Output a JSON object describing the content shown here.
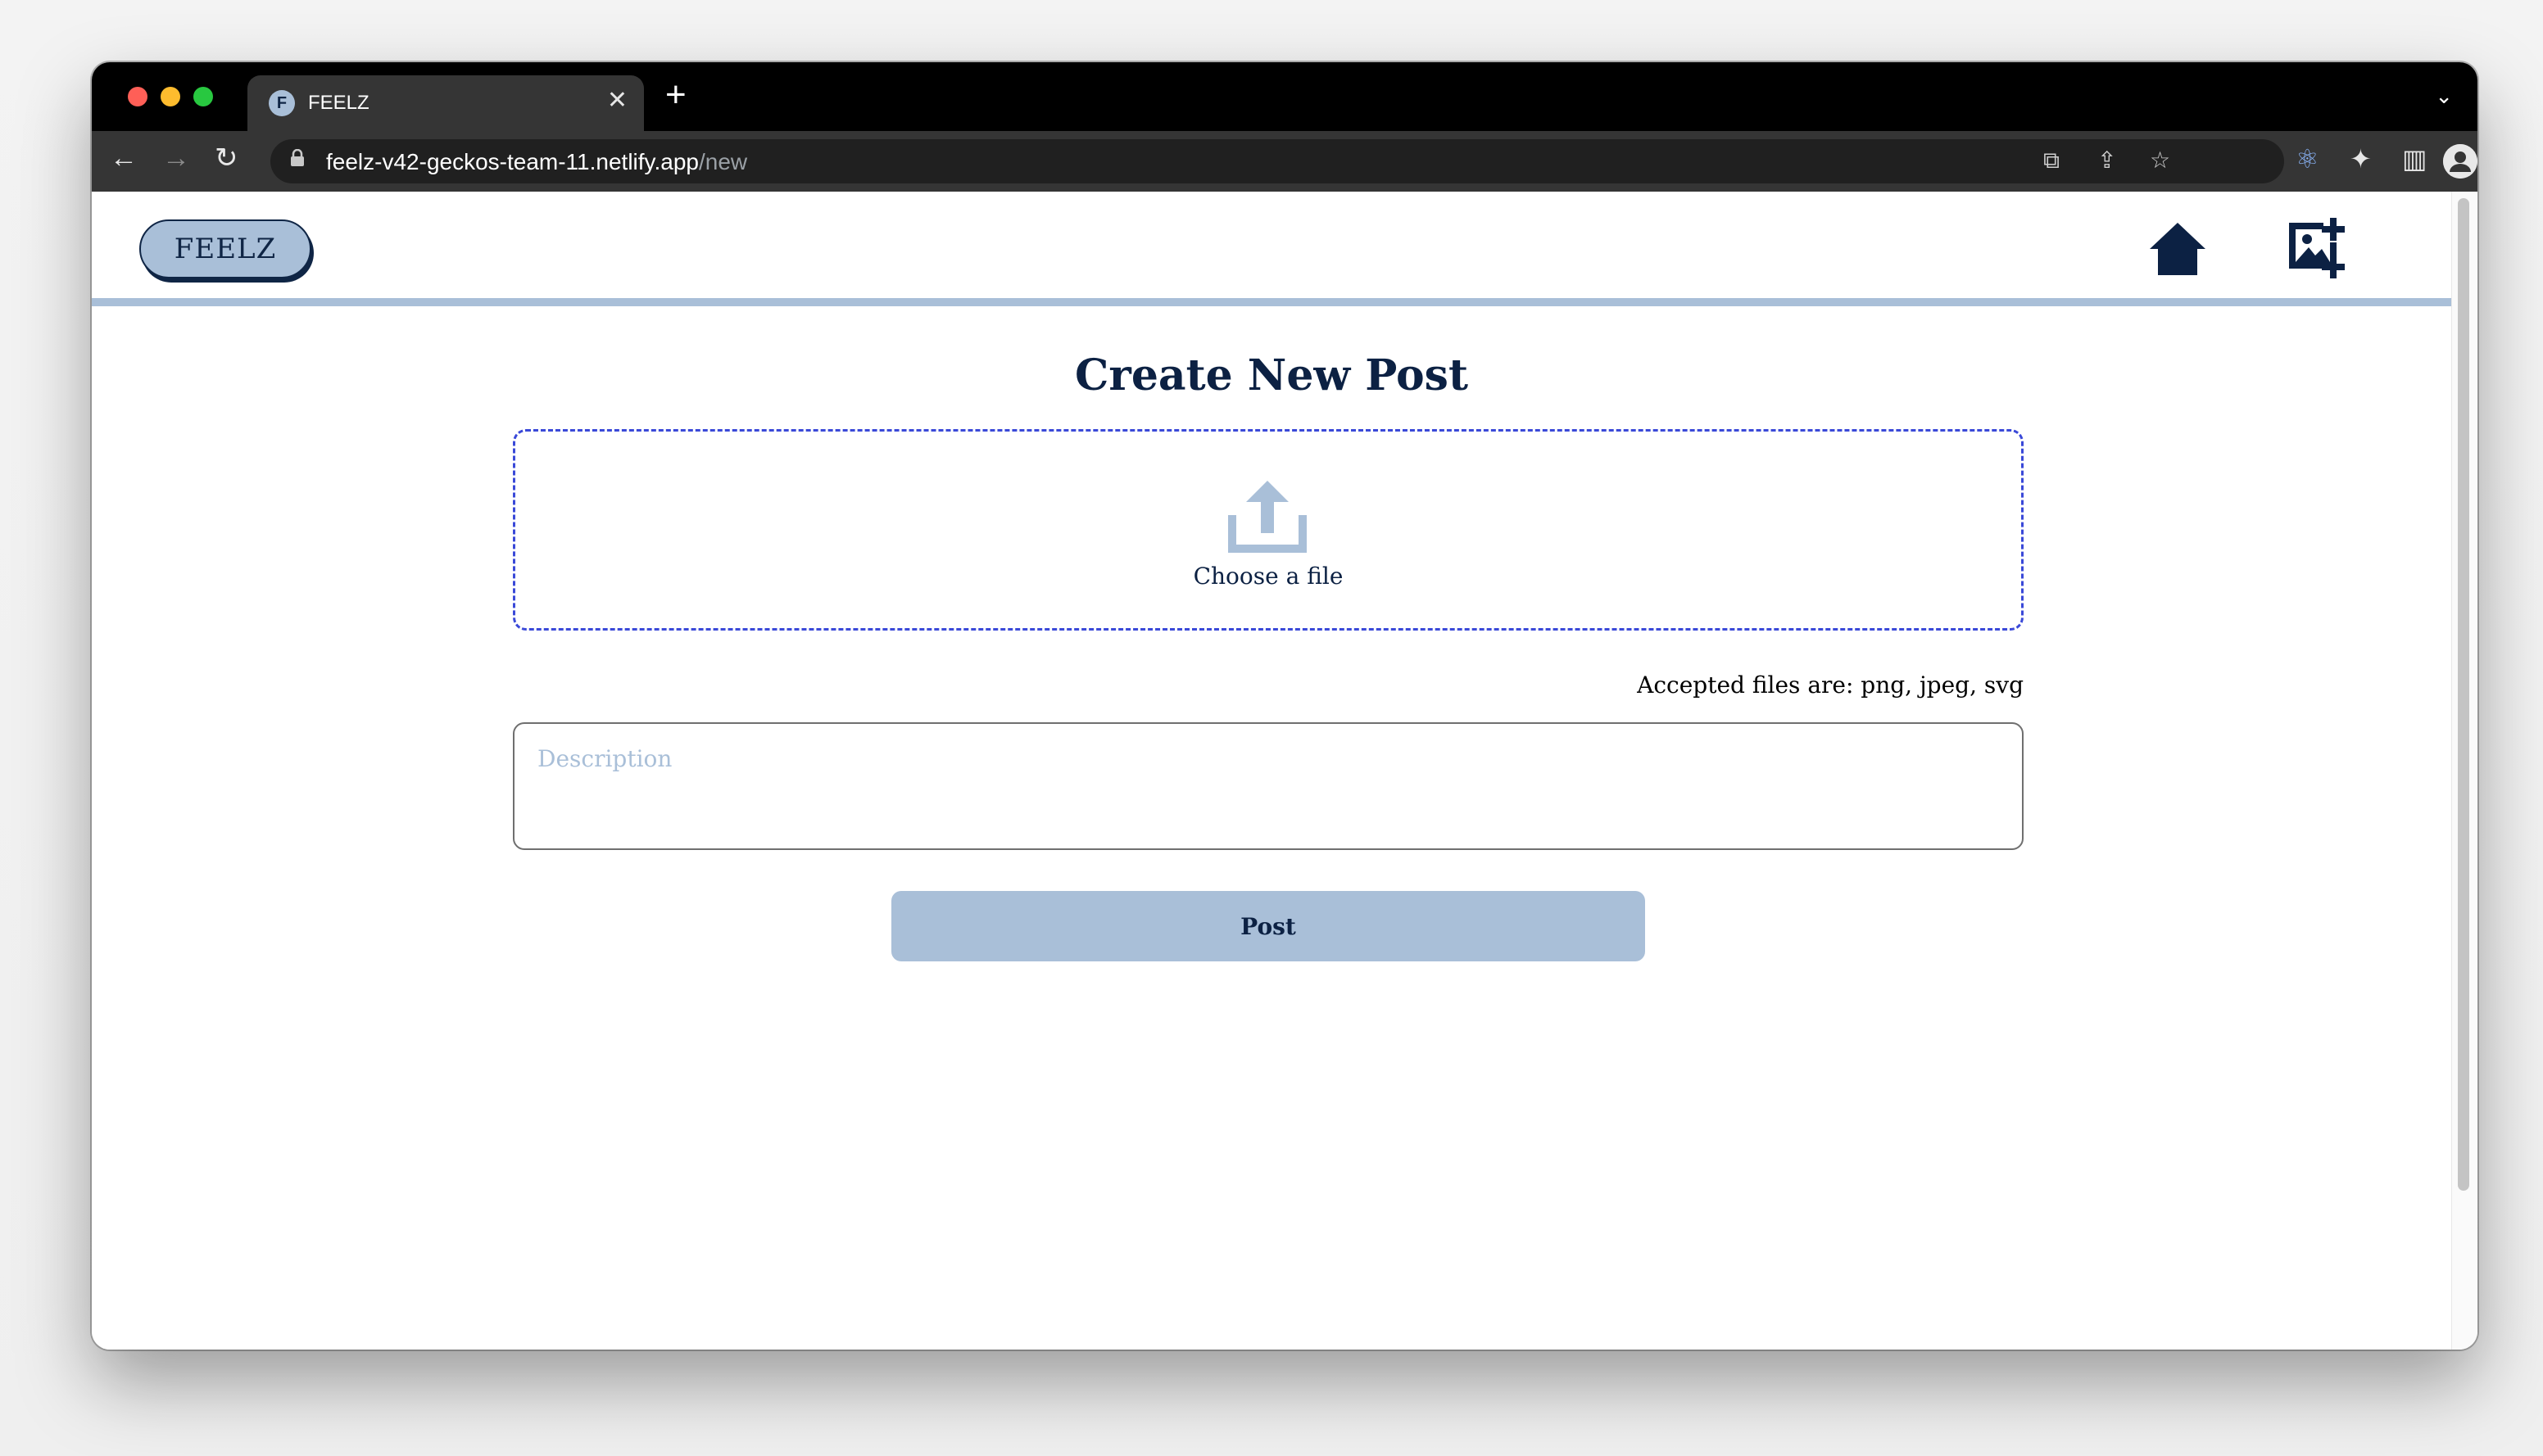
{
  "browser": {
    "tab": {
      "favicon_letter": "F",
      "title": "FEELZ",
      "close": "✕"
    },
    "new_tab": "+",
    "tab_menu": "⌄",
    "nav": {
      "back": "←",
      "forward": "→",
      "reload": "↻"
    },
    "address": {
      "lock": "🔒",
      "host": "feelz-v42-geckos-team-11.netlify.app",
      "path": "/new"
    },
    "omnibox_icons": {
      "translate": "⧉",
      "share": "⇪",
      "bookmark": "☆"
    },
    "toolbar_icons": {
      "react_devtools": "⚛",
      "extensions": "✦",
      "side_panel": "▥",
      "menu": "⋮"
    },
    "profile": "●"
  },
  "app": {
    "logo": "FEELZ",
    "colors": {
      "accent": "#a9bfd8",
      "navy": "#0c2143",
      "dropzone_border": "#3a49d8"
    }
  },
  "form": {
    "title": "Create New Post",
    "dropzone": {
      "label": "Choose a file",
      "icon": "upload-icon"
    },
    "accepted_files": "Accepted files are: png, jpeg, svg",
    "description": {
      "placeholder": "Description",
      "value": ""
    },
    "submit_label": "Post"
  }
}
